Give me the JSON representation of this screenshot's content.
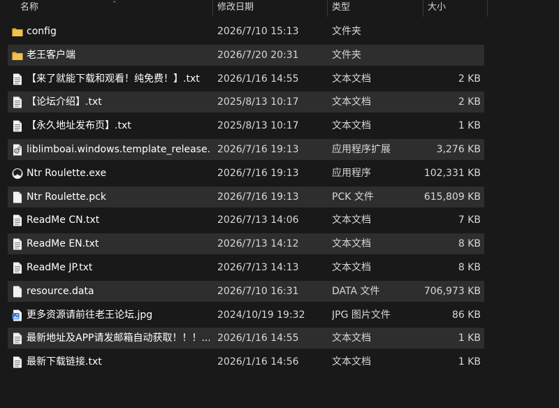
{
  "columns": {
    "name": "名称",
    "date": "修改日期",
    "type": "类型",
    "size": "大小"
  },
  "files": [
    {
      "name": "config",
      "date": "2026/7/10 15:13",
      "type": "文件夹",
      "size": "",
      "icon": "folder-icon"
    },
    {
      "name": "老王客户端",
      "date": "2026/7/20 20:31",
      "type": "文件夹",
      "size": "",
      "icon": "folder-icon"
    },
    {
      "name": "【来了就能下载和观看！纯免费！】.txt",
      "date": "2026/1/16 14:55",
      "type": "文本文档",
      "size": "2 KB",
      "icon": "text-file-icon"
    },
    {
      "name": "【论坛介绍】.txt",
      "date": "2025/8/13 10:17",
      "type": "文本文档",
      "size": "2 KB",
      "icon": "text-file-icon"
    },
    {
      "name": "【永久地址发布页】.txt",
      "date": "2025/8/13 10:17",
      "type": "文本文档",
      "size": "1 KB",
      "icon": "text-file-icon"
    },
    {
      "name": "liblimboai.windows.template_release...",
      "date": "2026/7/16 19:13",
      "type": "应用程序扩展",
      "size": "3,276 KB",
      "icon": "dll-file-icon"
    },
    {
      "name": "Ntr Roulette.exe",
      "date": "2026/7/16 19:13",
      "type": "应用程序",
      "size": "102,331 KB",
      "icon": "app-icon"
    },
    {
      "name": "Ntr Roulette.pck",
      "date": "2026/7/16 19:13",
      "type": "PCK 文件",
      "size": "615,809 KB",
      "icon": "blank-file-icon"
    },
    {
      "name": "ReadMe CN.txt",
      "date": "2026/7/13 14:06",
      "type": "文本文档",
      "size": "7 KB",
      "icon": "text-file-icon"
    },
    {
      "name": "ReadMe EN.txt",
      "date": "2026/7/13 14:12",
      "type": "文本文档",
      "size": "8 KB",
      "icon": "text-file-icon"
    },
    {
      "name": "ReadMe JP.txt",
      "date": "2026/7/13 14:13",
      "type": "文本文档",
      "size": "8 KB",
      "icon": "text-file-icon"
    },
    {
      "name": "resource.data",
      "date": "2026/7/10 16:31",
      "type": "DATA 文件",
      "size": "706,973 KB",
      "icon": "blank-file-icon"
    },
    {
      "name": "更多资源请前往老王论坛.jpg",
      "date": "2024/10/19 19:32",
      "type": "JPG 图片文件",
      "size": "86 KB",
      "icon": "image-file-icon"
    },
    {
      "name": "最新地址及APP请发邮箱自动获取！！！...",
      "date": "2026/1/16 14:55",
      "type": "文本文档",
      "size": "1 KB",
      "icon": "text-file-icon"
    },
    {
      "name": "最新下载链接.txt",
      "date": "2026/1/16 14:56",
      "type": "文本文档",
      "size": "1 KB",
      "icon": "text-file-icon"
    }
  ],
  "colors": {
    "background": "#191919",
    "row_alt": "#2e2e2e",
    "folder": "#f5c04a"
  }
}
